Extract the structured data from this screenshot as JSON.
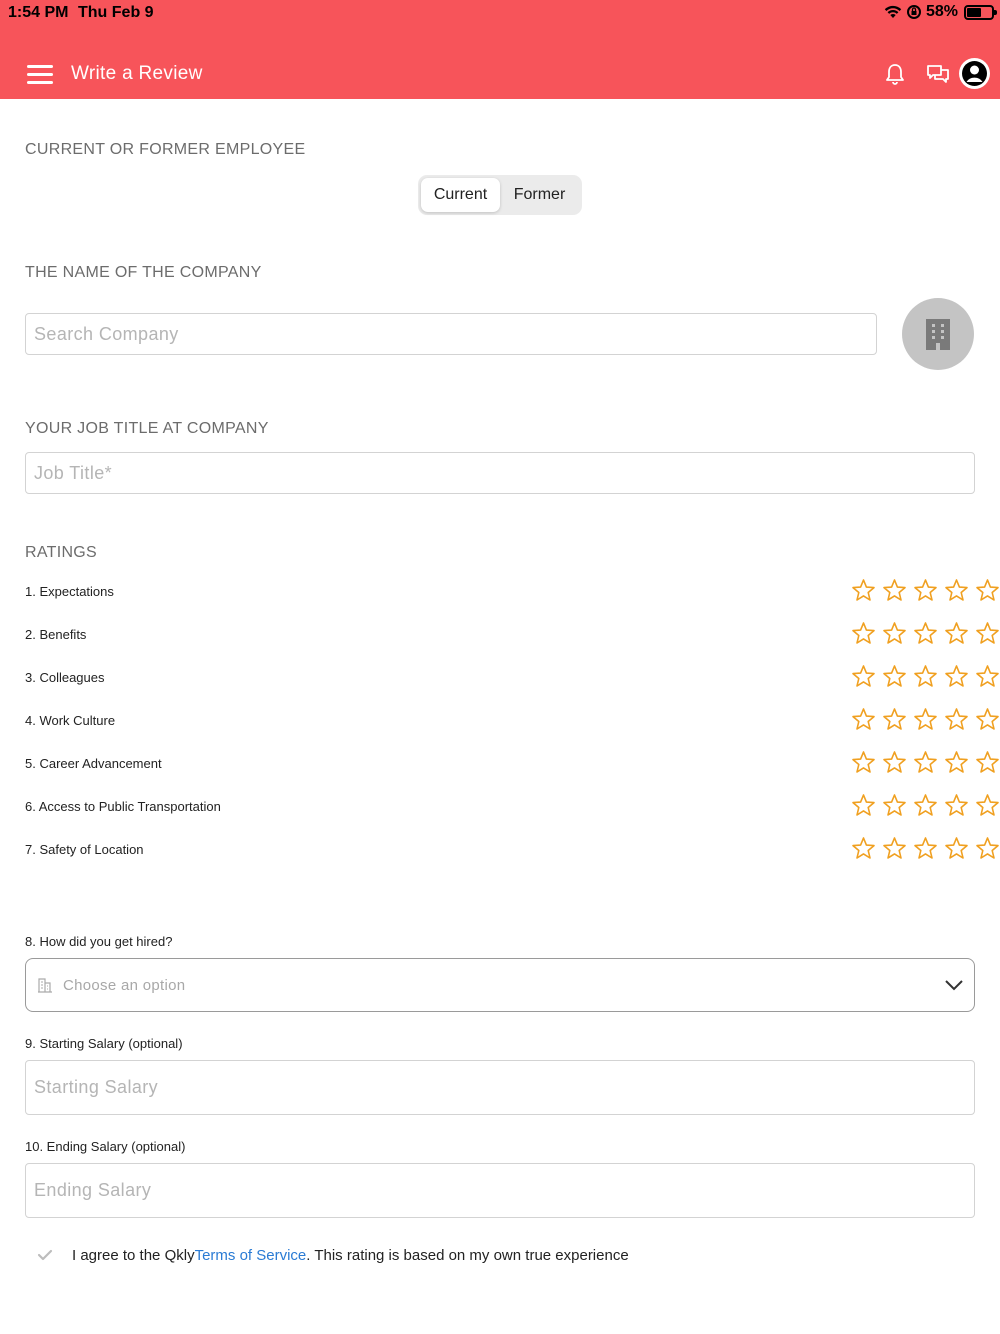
{
  "status_bar": {
    "time": "1:54 PM",
    "date": "Thu Feb 9",
    "battery": "58%"
  },
  "header": {
    "title": "Write a Review"
  },
  "employment": {
    "label": "CURRENT OR FORMER EMPLOYEE",
    "options": [
      "Current",
      "Former"
    ],
    "selected": "Current"
  },
  "company": {
    "label": "THE NAME OF THE COMPANY",
    "placeholder": "Search Company"
  },
  "job": {
    "label": "YOUR JOB TITLE AT COMPANY",
    "placeholder": "Job Title*"
  },
  "ratings": {
    "label": "RATINGS",
    "items": [
      {
        "label": "1. Expectations",
        "value": 0
      },
      {
        "label": "2. Benefits",
        "value": 0
      },
      {
        "label": "3. Colleagues",
        "value": 0
      },
      {
        "label": "4. Work Culture",
        "value": 0
      },
      {
        "label": "5. Career Advancement",
        "value": 0
      },
      {
        "label": "6. Access to Public Transportation",
        "value": 0
      },
      {
        "label": "7. Safety of Location",
        "value": 0
      }
    ],
    "max": 5,
    "star_color": "#f0a020"
  },
  "hired": {
    "label": "8. How did you get hired?",
    "placeholder": "Choose an option"
  },
  "starting_salary": {
    "label": "9. Starting Salary (optional)",
    "placeholder": "Starting Salary"
  },
  "ending_salary": {
    "label": "10. Ending Salary (optional)",
    "placeholder": "Ending Salary"
  },
  "agreement": {
    "prefix": "I agree to the Qkly ",
    "link": "Terms of Service",
    "suffix": ". This rating is based on my own true experience"
  },
  "colors": {
    "header": "#f7545a",
    "link": "#2a7bd4"
  }
}
